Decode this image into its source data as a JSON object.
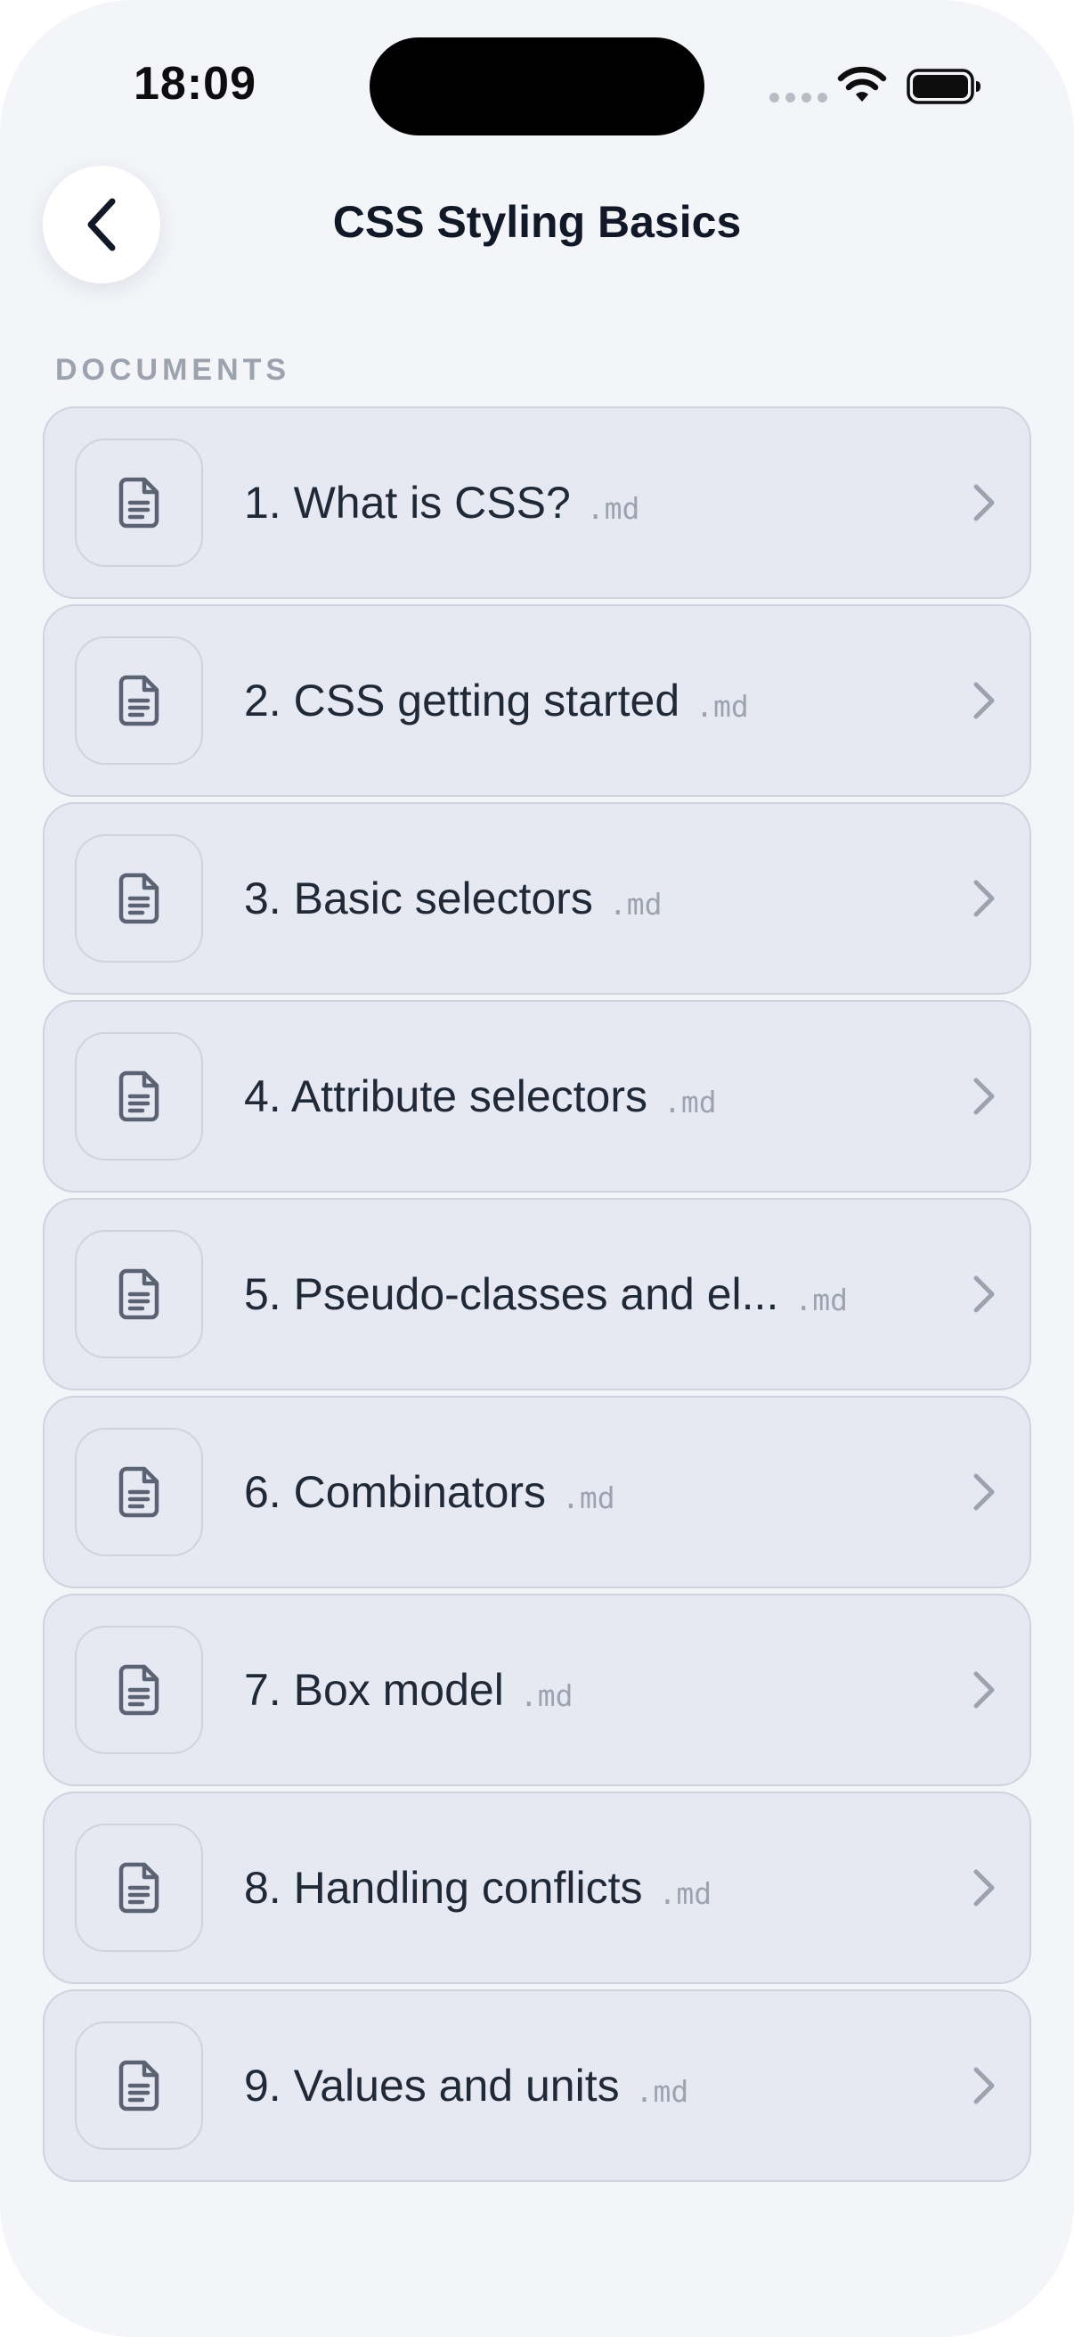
{
  "status": {
    "time": "18:09"
  },
  "header": {
    "title": "CSS Styling Basics"
  },
  "section": {
    "label": "DOCUMENTS"
  },
  "documents": [
    {
      "title": "1. What is CSS?",
      "ext": ".md"
    },
    {
      "title": "2. CSS getting started",
      "ext": ".md"
    },
    {
      "title": "3. Basic selectors",
      "ext": ".md"
    },
    {
      "title": "4. Attribute selectors",
      "ext": ".md"
    },
    {
      "title": "5. Pseudo-classes and el...",
      "ext": ".md"
    },
    {
      "title": "6. Combinators",
      "ext": ".md"
    },
    {
      "title": "7. Box model",
      "ext": ".md"
    },
    {
      "title": "8. Handling conflicts",
      "ext": ".md"
    },
    {
      "title": "9. Values and units",
      "ext": ".md"
    }
  ],
  "icons": {
    "back": "chevron-left-icon",
    "document": "file-text-icon",
    "row_arrow": "chevron-right-icon",
    "wifi": "wifi-icon",
    "battery": "battery-icon"
  },
  "colors": {
    "background": "#f4f5f9",
    "card": "#e7e9f2",
    "card_border": "#cfd3de",
    "text": "#1f2937",
    "muted": "#9ca3af"
  }
}
